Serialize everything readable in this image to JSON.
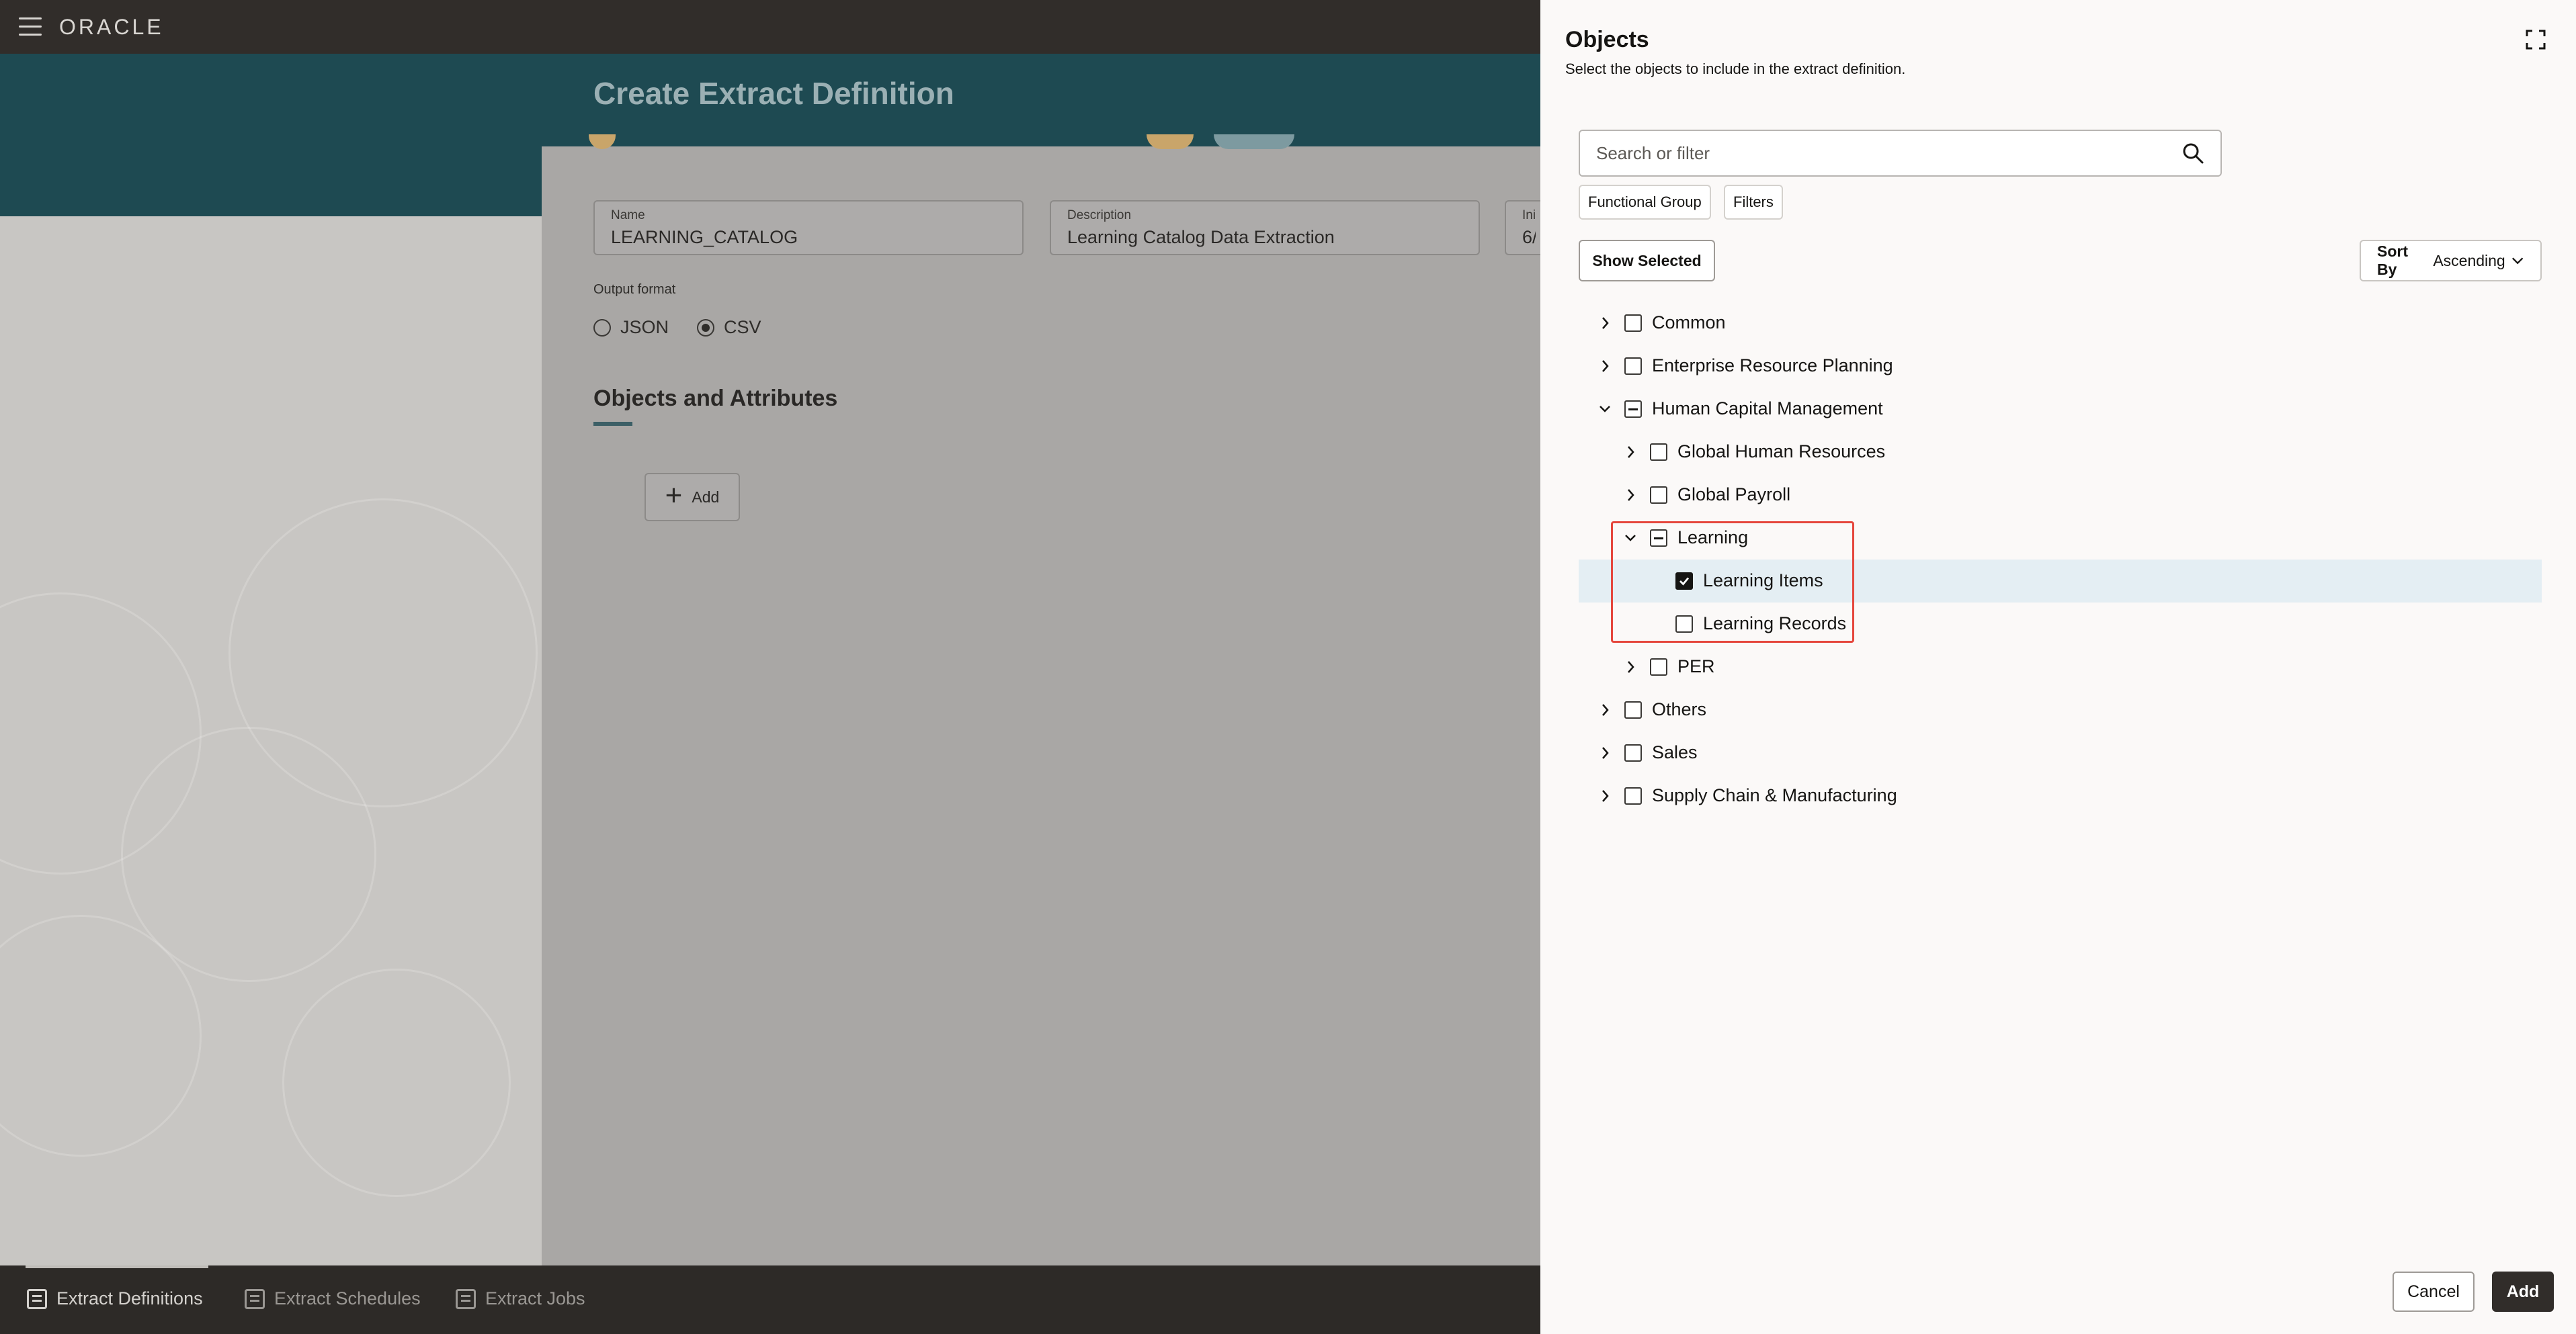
{
  "app": {
    "logo_text": "ORACLE",
    "page_title": "Create Extract Definition"
  },
  "form": {
    "name_label": "Name",
    "name_value": "LEARNING_CATALOG",
    "description_label": "Description",
    "description_value": "Learning Catalog Data Extraction",
    "third_field_label": "Ini",
    "third_field_value": "6/",
    "output_format_label": "Output format",
    "output_options": [
      {
        "label": "JSON",
        "selected": false
      },
      {
        "label": "CSV",
        "selected": true
      }
    ],
    "section_title": "Objects and Attributes",
    "add_label": "Add"
  },
  "bottom_nav": [
    {
      "label": "Extract Definitions",
      "icon": "document-icon",
      "active": true
    },
    {
      "label": "Extract Schedules",
      "icon": "calendar-icon",
      "active": false
    },
    {
      "label": "Extract Jobs",
      "icon": "jobs-lock-icon",
      "active": false
    }
  ],
  "drawer": {
    "title": "Objects",
    "subtitle": "Select the objects to include in the extract definition.",
    "search_placeholder": "Search or filter",
    "chips": [
      "Functional Group",
      "Filters"
    ],
    "show_selected_label": "Show Selected",
    "sort_prefix": "Sort By",
    "sort_value": "Ascending",
    "tree": [
      {
        "label": "Common",
        "level": 0,
        "expandable": true,
        "expanded": false,
        "state": "unchecked"
      },
      {
        "label": "Enterprise Resource Planning",
        "level": 0,
        "expandable": true,
        "expanded": false,
        "state": "unchecked"
      },
      {
        "label": "Human Capital Management",
        "level": 0,
        "expandable": true,
        "expanded": true,
        "state": "partial"
      },
      {
        "label": "Global Human Resources",
        "level": 1,
        "expandable": true,
        "expanded": false,
        "state": "unchecked"
      },
      {
        "label": "Global Payroll",
        "level": 1,
        "expandable": true,
        "expanded": false,
        "state": "unchecked"
      },
      {
        "label": "Learning",
        "level": 1,
        "expandable": true,
        "expanded": true,
        "state": "partial"
      },
      {
        "label": "Learning Items",
        "level": 2,
        "expandable": false,
        "expanded": false,
        "state": "checked",
        "selected": true
      },
      {
        "label": "Learning Records",
        "level": 2,
        "expandable": false,
        "expanded": false,
        "state": "unchecked"
      },
      {
        "label": "PER",
        "level": 1,
        "expandable": true,
        "expanded": false,
        "state": "unchecked"
      },
      {
        "label": "Others",
        "level": 0,
        "expandable": true,
        "expanded": false,
        "state": "unchecked"
      },
      {
        "label": "Sales",
        "level": 0,
        "expandable": true,
        "expanded": false,
        "state": "unchecked"
      },
      {
        "label": "Supply Chain & Manufacturing",
        "level": 0,
        "expandable": true,
        "expanded": false,
        "state": "unchecked"
      }
    ],
    "cancel_label": "Cancel",
    "add_label": "Add"
  },
  "colors": {
    "highlight": "#e5473d",
    "selected_row": "#e4eef3",
    "primary_button": "#312d2a"
  }
}
